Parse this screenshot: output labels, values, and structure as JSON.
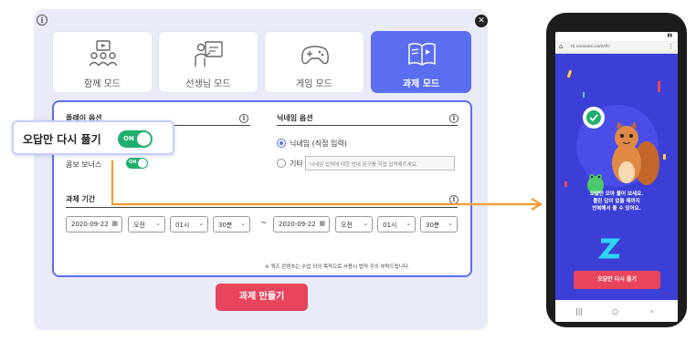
{
  "modal": {
    "info_icon": "i",
    "close_icon": "✕",
    "modes": [
      {
        "label": "함께 모드",
        "icon": "group-video-icon",
        "active": false
      },
      {
        "label": "선생님 모드",
        "icon": "teacher-board-icon",
        "active": false
      },
      {
        "label": "게임 모드",
        "icon": "gamepad-icon",
        "active": false
      },
      {
        "label": "과제 모드",
        "icon": "book-icon",
        "active": true
      }
    ],
    "play_options": {
      "title": "플레이 옵션",
      "combo_bonus_label": "콤보 보너스",
      "combo_bonus_toggle": "ON"
    },
    "nickname_options": {
      "title": "닉네임 옵션",
      "direct_label": "닉네임 (직접 입력)",
      "other_label": "기타",
      "other_placeholder": "닉네임 입력에 대한 안내 문구를 직접 입력해주세요."
    },
    "period": {
      "title": "과제 기간",
      "start": {
        "date": "2020-09-22",
        "ampm": "오전",
        "hour": "01시",
        "minute": "30분"
      },
      "end": {
        "date": "2020-09-22",
        "ampm": "오전",
        "hour": "01시",
        "minute": "30분"
      },
      "separator": "~"
    },
    "footnote": "※ 퀴즈 콘텐츠는 수업 외의 목적으로 사용시 법적 주의 부탁드립니다.",
    "create_button": "과제 만들기"
  },
  "callout": {
    "label": "오답만 다시 풀기",
    "toggle": "ON"
  },
  "phone": {
    "url": "m.vivasam.com/#/",
    "message_lines": [
      "오답만 모아 풀어 보세요.",
      "틀린 답이 없을 때까지",
      "반복해서 풀 수 있어요."
    ],
    "retry_button": "오답만 다시 풀기"
  },
  "colors": {
    "accent": "#5b6ef0",
    "toggle_on": "#1fae6d",
    "create": "#e8455c",
    "arrow": "#f39c33",
    "phone_bg": "#3c3fd6"
  }
}
